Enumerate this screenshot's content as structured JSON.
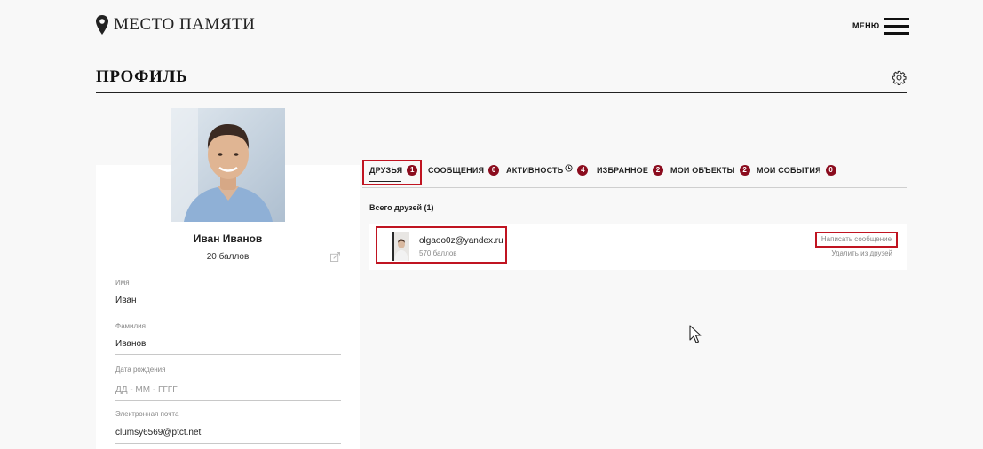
{
  "header": {
    "brand": "МЕСТО ПАМЯТИ",
    "menu_label": "МЕНЮ"
  },
  "page": {
    "title": "ПРОФИЛЬ"
  },
  "profile": {
    "name": "Иван Иванов",
    "points": "20 баллов",
    "fields": {
      "first_name": {
        "label": "Имя",
        "value": "Иван"
      },
      "last_name": {
        "label": "Фамилия",
        "value": "Иванов"
      },
      "birth_date": {
        "label": "Дата рождения",
        "placeholder": "ДД - ММ - ГГГГ"
      },
      "email": {
        "label": "Электронная почта",
        "value": "clumsy6569@ptct.net"
      }
    }
  },
  "tabs": [
    {
      "label": "ДРУЗЬЯ",
      "badge": "1"
    },
    {
      "label": "СООБЩЕНИЯ",
      "badge": "0"
    },
    {
      "label": "АКТИВНОСТЬ",
      "badge": "4"
    },
    {
      "label": "ИЗБРАННОЕ",
      "badge": "2"
    },
    {
      "label": "МОИ ОБЪЕКТЫ",
      "badge": "2"
    },
    {
      "label": "МОИ СОБЫТИЯ",
      "badge": "0"
    }
  ],
  "friends": {
    "total_label": "Всего друзей (1)",
    "items": [
      {
        "email": "olgaoo0z@yandex.ru",
        "points": "570 баллов",
        "write_label": "Написать сообщение",
        "remove_label": "Удалить из друзей"
      }
    ]
  },
  "colors": {
    "accent": "#c01421",
    "badge": "#8b0c1e",
    "background": "#f8f8f8"
  }
}
